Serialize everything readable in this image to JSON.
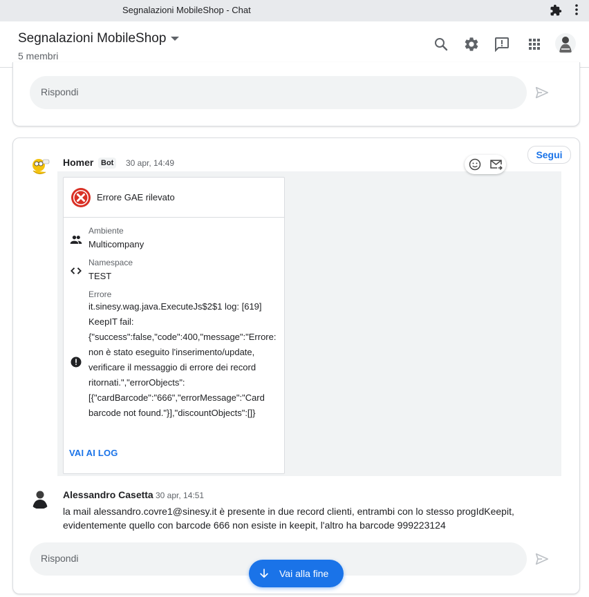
{
  "window": {
    "title": "Segnalazioni MobileShop - Chat"
  },
  "header": {
    "room_name": "Segnalazioni MobileShop",
    "members": "5 membri"
  },
  "composer": {
    "placeholder": "Rispondi"
  },
  "thread": {
    "follow_label": "Segui",
    "bot_message": {
      "sender": "Homer",
      "badge": "Bot",
      "time": "30 apr, 14:49",
      "card": {
        "header": "Errore GAE rilevato",
        "fields": [
          {
            "label": "Ambiente",
            "value": "Multicompany",
            "icon": "group-icon"
          },
          {
            "label": "Namespace",
            "value": "TEST",
            "icon": "code-icon"
          },
          {
            "label": "Errore",
            "value": "it.sinesy.wag.java.ExecuteJs$2$1 log: [619] KeepIT fail: {\"success\":false,\"code\":400,\"message\":\"Errore: non è stato eseguito l'inserimento/update, verificare il messaggio di errore dei record ritornati.\",\"errorObjects\": [{\"cardBarcode\":\"666\",\"errorMessage\":\"Card barcode not found.\"}],\"discountObjects\":[]}",
            "icon": "error-icon"
          }
        ],
        "button": "VAI AI LOG"
      }
    },
    "reply_message": {
      "sender": "Alessandro Casetta",
      "time": "30 apr, 14:51",
      "text": "la mail alessandro.covre1@sinesy.it è presente in due record clienti, entrambi con lo stesso progIdKeepit, evidentemente quello con barcode 666 non esiste in keepit, l'altro ha barcode 999223124"
    }
  },
  "fab": {
    "label": "Vai alla fine"
  },
  "colors": {
    "accent": "#1a73e8",
    "error": "#d93025"
  }
}
